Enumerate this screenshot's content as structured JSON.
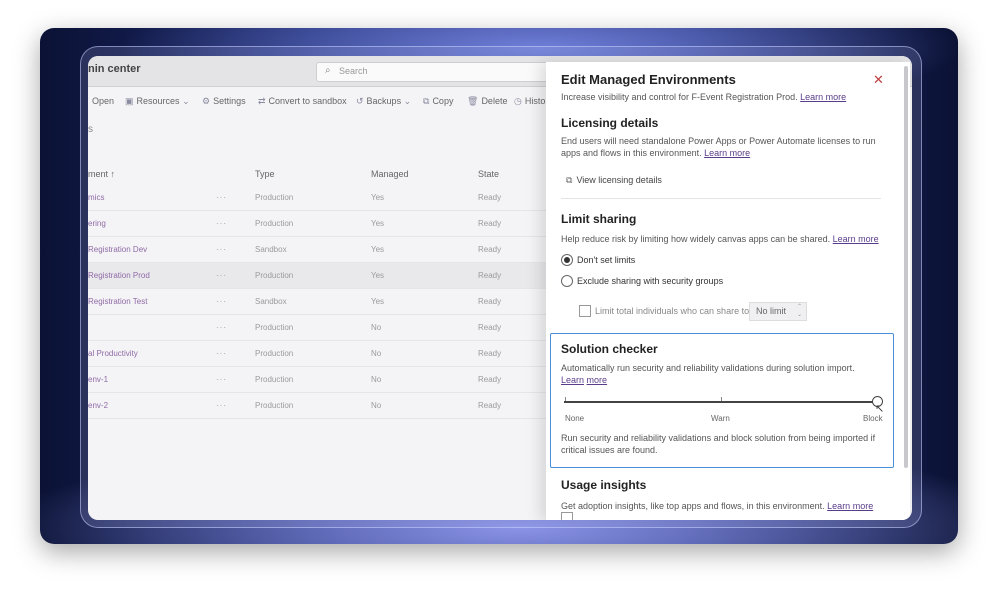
{
  "app": {
    "title": "nin center"
  },
  "search": {
    "placeholder": "Search"
  },
  "commands": [
    {
      "icon": "",
      "label": "Open"
    },
    {
      "icon": "resources-icon",
      "label": "Resources"
    },
    {
      "icon": "gear-icon",
      "label": "Settings"
    },
    {
      "icon": "convert-icon",
      "label": "Convert to sandbox"
    },
    {
      "icon": "backups-icon",
      "label": "Backups"
    },
    {
      "icon": "copy-icon",
      "label": "Copy"
    },
    {
      "icon": "trash-icon",
      "label": "Delete"
    },
    {
      "icon": "history-icon",
      "label": "Histo"
    }
  ],
  "breadcrumb": "s",
  "table": {
    "headers": {
      "name": "ment ↑",
      "type": "Type",
      "managed": "Managed",
      "state": "State"
    },
    "rows": [
      {
        "name": "mics",
        "type": "Production",
        "managed": "Yes",
        "state": "Ready"
      },
      {
        "name": "ering",
        "type": "Production",
        "managed": "Yes",
        "state": "Ready"
      },
      {
        "name": "Registration Dev",
        "type": "Sandbox",
        "managed": "Yes",
        "state": "Ready"
      },
      {
        "name": "Registration Prod",
        "type": "Production",
        "managed": "Yes",
        "state": "Ready"
      },
      {
        "name": "Registration Test",
        "type": "Sandbox",
        "managed": "Yes",
        "state": "Ready"
      },
      {
        "name": "",
        "type": "Production",
        "managed": "No",
        "state": "Ready"
      },
      {
        "name": "al Productivity",
        "type": "Production",
        "managed": "No",
        "state": "Ready"
      },
      {
        "name": "env-1",
        "type": "Production",
        "managed": "No",
        "state": "Ready"
      },
      {
        "name": "env-2",
        "type": "Production",
        "managed": "No",
        "state": "Ready"
      }
    ],
    "more": "···"
  },
  "panel": {
    "title": "Edit Managed Environments",
    "subtitle": "Increase visibility and control for F-Event Registration Prod.",
    "learn_more": "Learn more",
    "close": "✕",
    "licensing": {
      "heading": "Licensing details",
      "text": "End users will need standalone Power Apps or Power Automate licenses to run apps and flows in this environment.",
      "learn_more": "Learn more",
      "view": "View licensing details"
    },
    "sharing": {
      "heading": "Limit sharing",
      "text": "Help reduce risk by limiting how widely canvas apps can be shared.",
      "learn_more": "Learn more",
      "option_none": "Don't set limits",
      "option_exclude": "Exclude sharing with security groups",
      "limit_label": "Limit total individuals who can share to",
      "limit_value": "No limit"
    },
    "solution": {
      "heading": "Solution checker",
      "text": "Automatically run security and reliability validations during solution import.",
      "learn_more_1": "Learn",
      "learn_more_2": "more",
      "labels": [
        "None",
        "Warn",
        "Block"
      ],
      "level": 2,
      "description": "Run security and reliability validations and block solution from being imported if critical issues are found."
    },
    "usage": {
      "heading": "Usage insights",
      "text": "Get adoption insights, like top apps and flows, in this environment.",
      "learn_more": "Learn more"
    }
  }
}
